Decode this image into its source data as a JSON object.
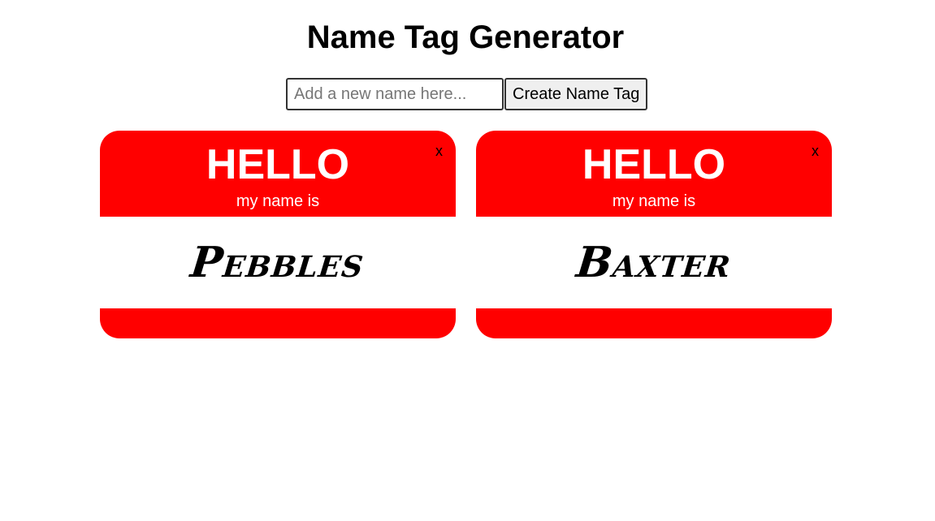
{
  "header": {
    "title": "Name Tag Generator"
  },
  "form": {
    "placeholder": "Add a new name here...",
    "value": "",
    "button_label": "Create Name Tag"
  },
  "tags": [
    {
      "hello": "HELLO",
      "subtitle": "my name is",
      "name": "Pebbles",
      "close_label": "x"
    },
    {
      "hello": "HELLO",
      "subtitle": "my name is",
      "name": "Baxter",
      "close_label": "x"
    }
  ],
  "colors": {
    "tag_red": "#ff0000",
    "text_white": "#ffffff"
  }
}
